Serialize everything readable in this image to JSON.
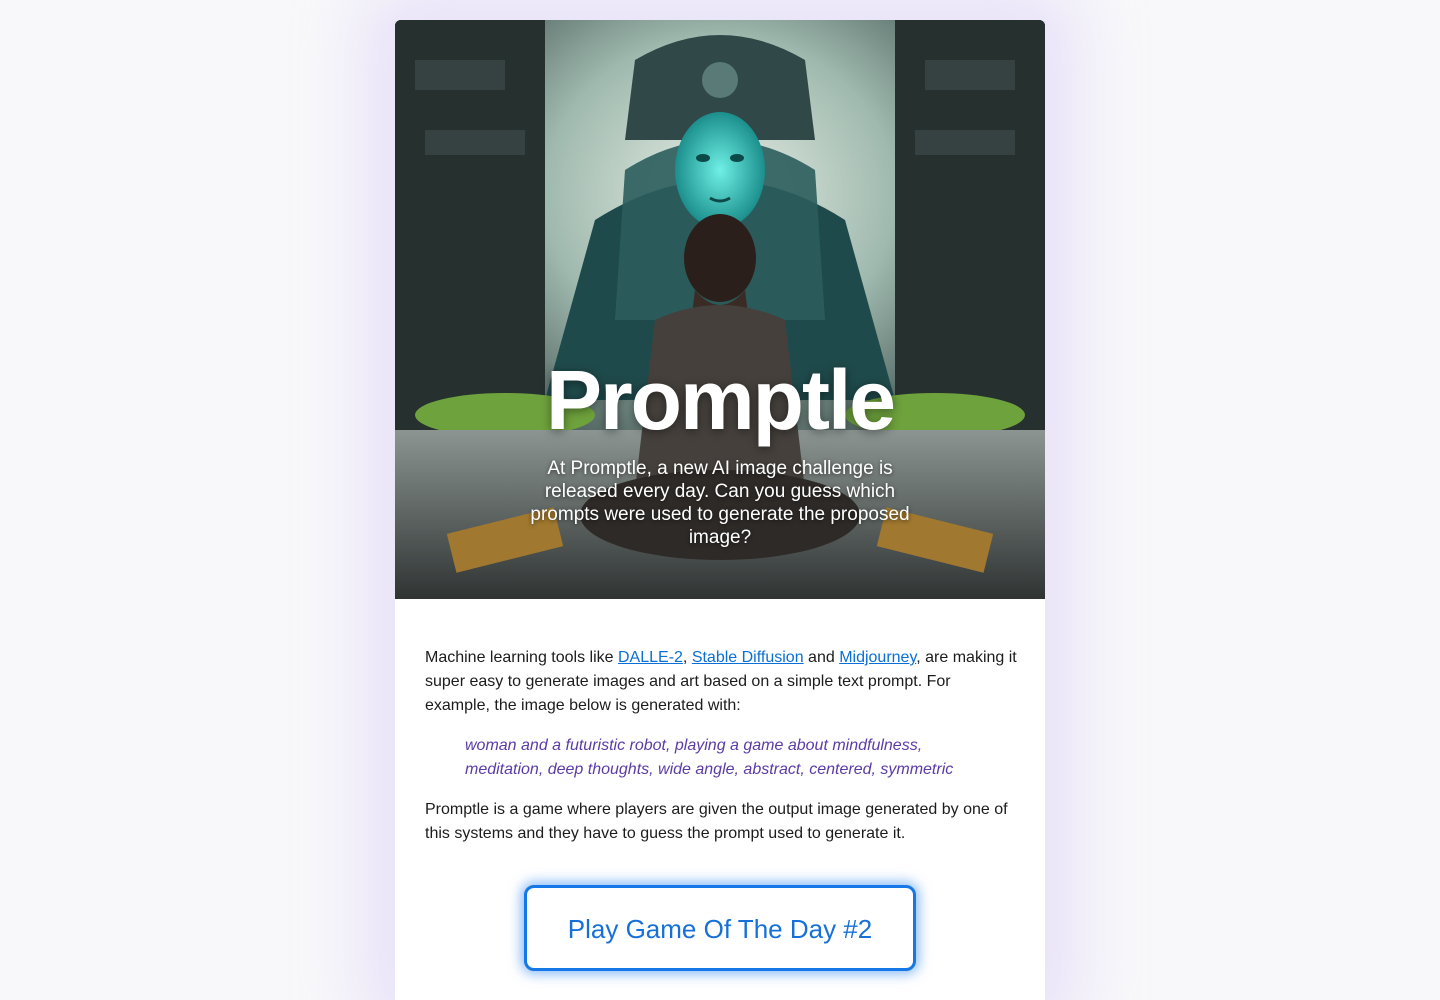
{
  "hero": {
    "title": "Promptle",
    "subtitle": "At Promptle, a new AI image challenge is released every day. Can you guess which prompts were used to generate the proposed image?"
  },
  "intro": {
    "text_before": "Machine learning tools like ",
    "links": [
      {
        "label": "DALLE-2"
      },
      {
        "label": "Stable Diffusion"
      },
      {
        "label": "Midjourney"
      }
    ],
    "sep_comma": ", ",
    "sep_and": " and ",
    "text_after": ", are making it super easy to generate images and art based on a simple text prompt. For example, the image below is generated with:"
  },
  "example_prompt": "woman and a futuristic robot, playing a game about mindfulness, meditation, deep thoughts, wide angle, abstract, centered, symmetric",
  "description": "Promptle is a game where players are given the output image generated by one of this systems and they have to guess the prompt used to generate it.",
  "cta": {
    "label": "Play Game Of The Day #2"
  },
  "colors": {
    "link": "#0a6fd6",
    "quote": "#5b3ba6",
    "button_border": "#1677e6",
    "button_text": "#1670d8"
  },
  "hero_image": {
    "icon": "meditation-robot-illustration"
  }
}
